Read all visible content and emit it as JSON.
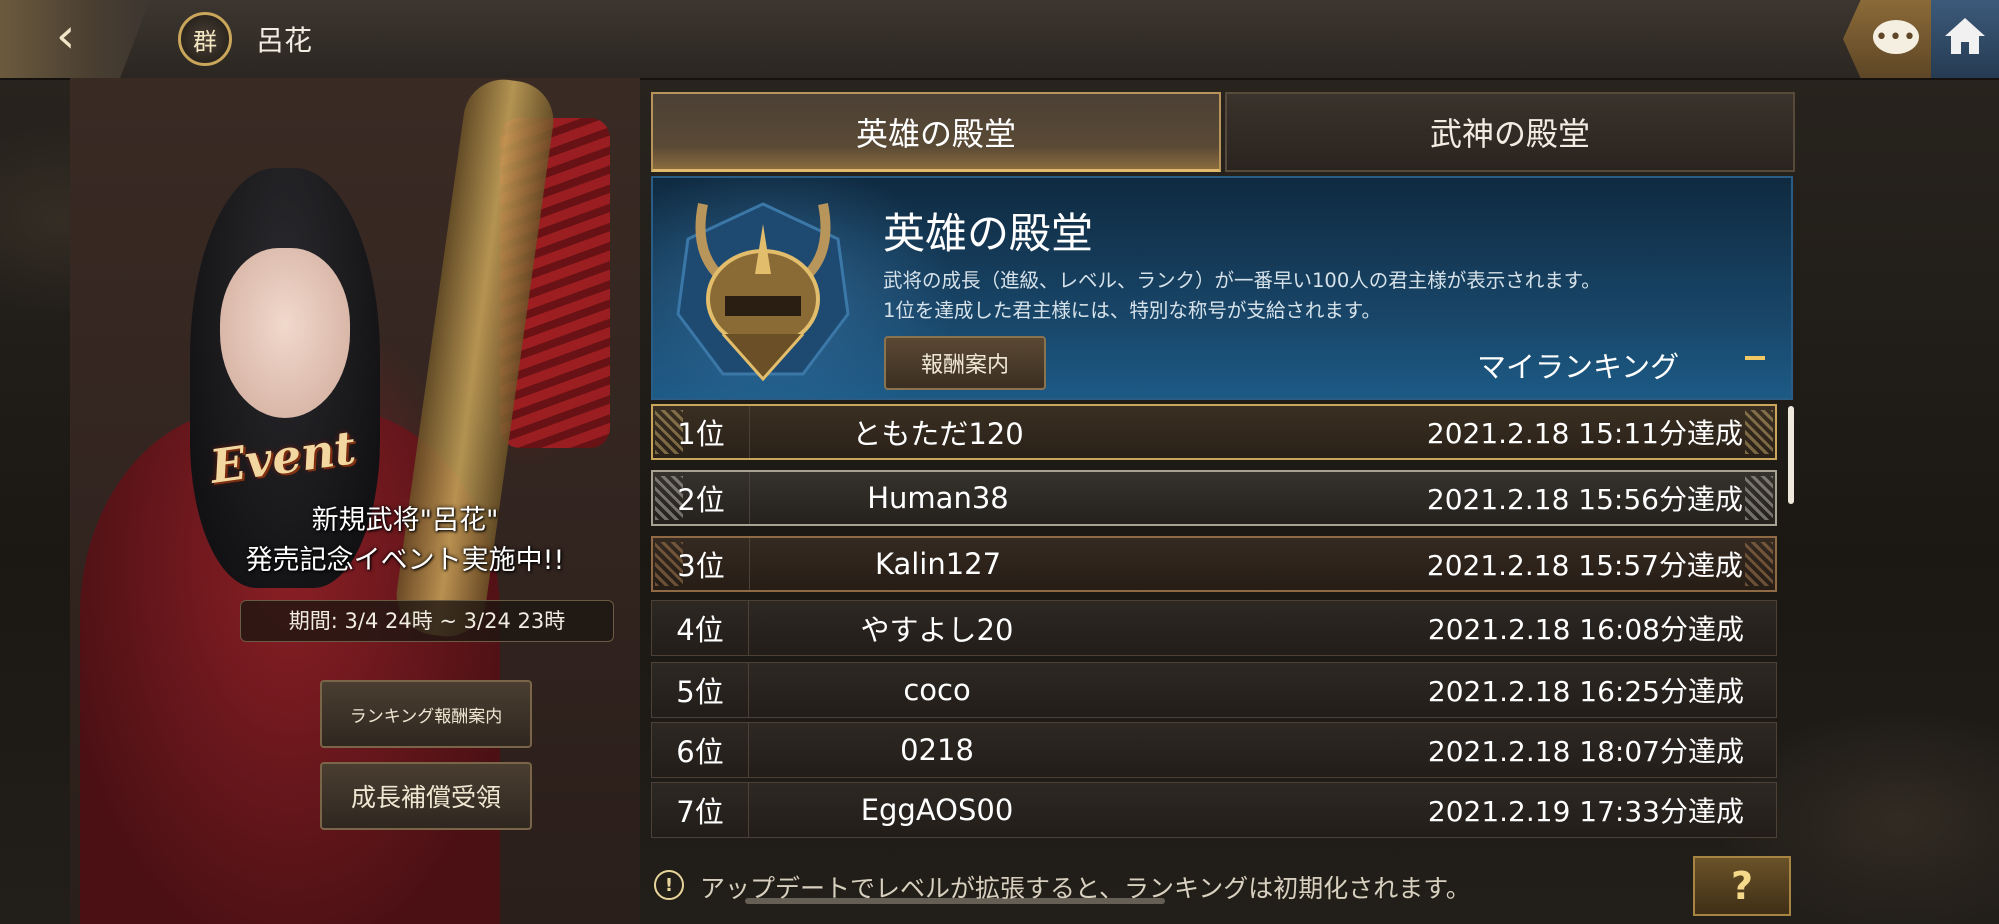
{
  "header": {
    "back_icon": "‹",
    "faction_badge": "群",
    "character_name": "呂花",
    "chat_icon": "chat-bubble-icon",
    "home_icon": "home-icon"
  },
  "event": {
    "logo": "Event",
    "line1": "新規武将\"呂花\"",
    "line2": "発売記念イベント実施中!!",
    "period": "期間: 3/4 24時 ~ 3/24 23時"
  },
  "side_buttons": {
    "ranking_reward": "ランキング報酬案内",
    "growth_compensation": "成長補償受領"
  },
  "tabs": [
    {
      "label": "英雄の殿堂",
      "active": true
    },
    {
      "label": "武神の殿堂",
      "active": false
    }
  ],
  "banner": {
    "title": "英雄の殿堂",
    "desc1": "武将の成長（進級、レベル、ランク）が一番早い100人の君主様が表示されます。",
    "desc2": "1位を達成した君主様には、特別な称号が支給されます。",
    "reward_button": "報酬案内",
    "my_ranking": "マイランキング"
  },
  "rankings": [
    {
      "rank": "1位",
      "name": "ともただ120",
      "time": "2021.2.18 15:11分達成"
    },
    {
      "rank": "2位",
      "name": "Human38",
      "time": "2021.2.18 15:56分達成"
    },
    {
      "rank": "3位",
      "name": "Kalin127",
      "time": "2021.2.18 15:57分達成"
    },
    {
      "rank": "4位",
      "name": "やすよし20",
      "time": "2021.2.18 16:08分達成"
    },
    {
      "rank": "5位",
      "name": "coco",
      "time": "2021.2.18 16:25分達成"
    },
    {
      "rank": "6位",
      "name": "0218",
      "time": "2021.2.18 18:07分達成"
    },
    {
      "rank": "7位",
      "name": "EggAOS00",
      "time": "2021.2.19 17:33分達成"
    }
  ],
  "footer": {
    "notice_icon": "!",
    "notice": "アップデートでレベルが拡張すると、ランキングは初期化されます。",
    "help": "?"
  },
  "colors": {
    "gold": "#c9a65a",
    "banner_blue": "#184466",
    "accent_yellow": "#f2c865"
  }
}
